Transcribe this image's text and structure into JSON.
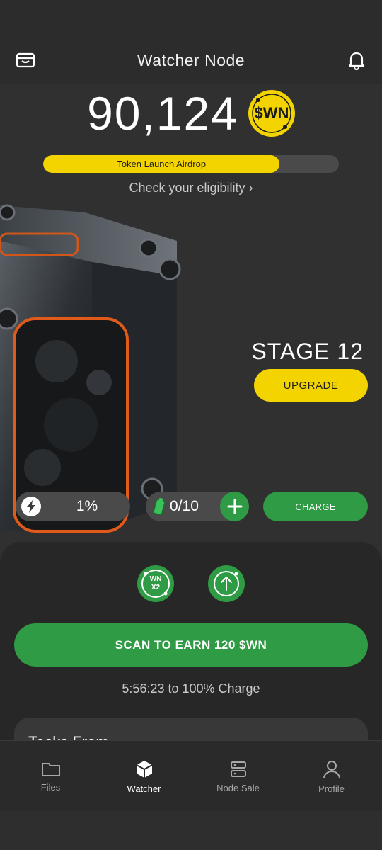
{
  "header": {
    "title": "Watcher Node",
    "left_icon": "wallet-icon",
    "right_icon": "bell-icon"
  },
  "balance": {
    "amount": "90,124",
    "coin_symbol": "$WN",
    "coin_color": "#F3D400"
  },
  "airdrop": {
    "label": "Token Launch Airdrop",
    "progress_percent": 80,
    "link_text": "Check your eligibility ›"
  },
  "stage": {
    "label": "STAGE 12",
    "upgrade_label": "UPGRADE"
  },
  "stats": {
    "energy_value": "1%",
    "battery_value": "0/10",
    "charge_label": "CHARGE"
  },
  "boosts": [
    {
      "label": "WN\nX2",
      "icon": "multiplier-badge-icon"
    },
    {
      "icon": "arrow-up-circle-icon"
    }
  ],
  "scan": {
    "label": "SCAN TO EARN 120 $WN",
    "timer": "5:56:23 to 100% Charge"
  },
  "tasks": {
    "title": "Tasks From"
  },
  "nav": {
    "items": [
      {
        "label": "Files",
        "icon": "folder-icon",
        "active": false
      },
      {
        "label": "Watcher",
        "icon": "cube-icon",
        "active": true
      },
      {
        "label": "Node Sale",
        "icon": "server-icon",
        "active": false
      },
      {
        "label": "Profile",
        "icon": "user-icon",
        "active": false
      }
    ]
  },
  "colors": {
    "accent_green": "#2F9B45",
    "accent_yellow": "#F3D400",
    "background": "#303030"
  }
}
